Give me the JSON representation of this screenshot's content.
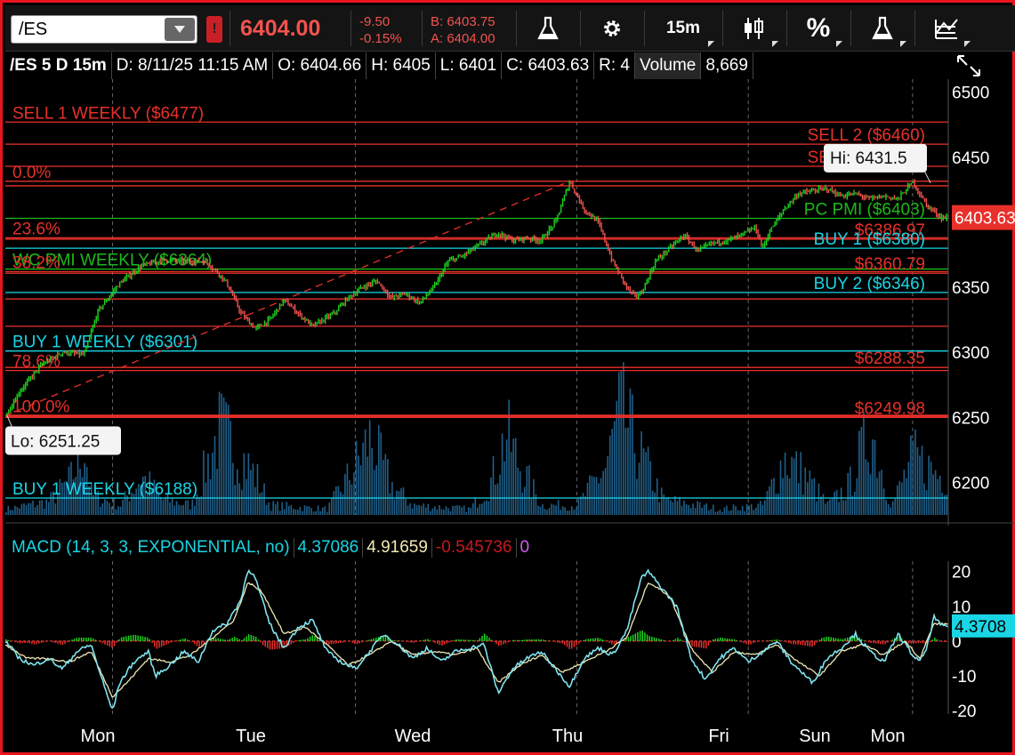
{
  "toolbar": {
    "symbol": "/ES",
    "alert_glyph": "!",
    "last": "6404.00",
    "change": "-9.50",
    "change_pct": "-0.15%",
    "bid": "B: 6403.75",
    "ask": "A: 6404.00",
    "timeframe": "15m",
    "percent": "%",
    "icons": [
      "flask-icon",
      "gear-icon",
      "timeframe-button",
      "candle-style-icon",
      "percent-icon",
      "flask-icon",
      "drawing-icon"
    ]
  },
  "info": {
    "symbol": "/ES 5 D 15m",
    "date": "D: 8/11/25 11:15 AM",
    "open": "O: 6404.66",
    "high": "H: 6405",
    "low": "L: 6401",
    "close": "C: 6403.63",
    "range": "R: 4",
    "vol_label": "Volume",
    "vol_value": "8,669"
  },
  "colors": {
    "up": "#1ed41e",
    "down": "#f2534e",
    "red_line": "#e8302a",
    "cyan_line": "#19d5e5",
    "green_line": "#1bb91b",
    "volume": "#1f5f8a",
    "macd": "#7fe3ef",
    "signal": "#f0e9b4"
  },
  "chart_data": [
    {
      "type": "candlestick",
      "ylim": [
        6175,
        6510
      ],
      "y_ticks": [
        6200,
        6250,
        6300,
        6350,
        6400,
        6450,
        6500
      ],
      "x_ticks": [
        "Mon",
        "Tue",
        "Wed",
        "Thu",
        "Fri",
        "Sun",
        "Mon"
      ],
      "grid": false,
      "price_path": [
        [
          0,
          6251
        ],
        [
          2,
          6270
        ],
        [
          5,
          6290
        ],
        [
          8,
          6300
        ],
        [
          11,
          6298
        ],
        [
          13,
          6332
        ],
        [
          16,
          6353
        ],
        [
          19,
          6366
        ],
        [
          22,
          6371
        ],
        [
          25,
          6370
        ],
        [
          28,
          6370
        ],
        [
          30,
          6360
        ],
        [
          31,
          6353
        ],
        [
          33,
          6330
        ],
        [
          35,
          6318
        ],
        [
          37,
          6325
        ],
        [
          39,
          6340
        ],
        [
          41,
          6330
        ],
        [
          43,
          6320
        ],
        [
          46,
          6330
        ],
        [
          48,
          6342
        ],
        [
          50,
          6350
        ],
        [
          52,
          6355
        ],
        [
          54,
          6342
        ],
        [
          56,
          6345
        ],
        [
          58,
          6338
        ],
        [
          60,
          6350
        ],
        [
          62,
          6370
        ],
        [
          64,
          6374
        ],
        [
          67,
          6385
        ],
        [
          69,
          6392
        ],
        [
          71,
          6386
        ],
        [
          73,
          6388
        ],
        [
          75,
          6386
        ],
        [
          77,
          6400
        ],
        [
          79,
          6431.5
        ],
        [
          81,
          6410
        ],
        [
          83,
          6400
        ],
        [
          85,
          6370
        ],
        [
          87,
          6350
        ],
        [
          88,
          6343
        ],
        [
          89,
          6345
        ],
        [
          91,
          6370
        ],
        [
          93,
          6380
        ],
        [
          95,
          6390
        ],
        [
          97,
          6378
        ],
        [
          99,
          6384
        ],
        [
          101,
          6386
        ],
        [
          103,
          6390
        ],
        [
          105,
          6396
        ],
        [
          106,
          6380
        ],
        [
          107,
          6393
        ],
        [
          109,
          6410
        ],
        [
          111,
          6422
        ],
        [
          113,
          6424
        ],
        [
          115,
          6426
        ],
        [
          117,
          6420
        ],
        [
          119,
          6422
        ],
        [
          121,
          6418
        ],
        [
          123,
          6420
        ],
        [
          125,
          6418
        ],
        [
          127,
          6431
        ],
        [
          129,
          6413
        ],
        [
          131,
          6403.63
        ]
      ],
      "x_max": 132,
      "hi_label": "Hi: 6431.5",
      "lo_label": "Lo: 6251.25",
      "hi": 6431.5,
      "lo": 6251.25,
      "last_price_label": "6403.63",
      "fib_trend": {
        "from": [
          0,
          6251.25
        ],
        "to": [
          79,
          6431.5
        ]
      },
      "levels": [
        {
          "price": 6477,
          "color": "red",
          "label": "SELL 1 WEEKLY ($6477)",
          "label_side": "left"
        },
        {
          "price": 6460,
          "color": "red",
          "label": "SELL 2 ($6460)",
          "label_side": "right"
        },
        {
          "price": 6443,
          "color": "red",
          "label": "SELL 1 ($6443)",
          "label_side": "right"
        },
        {
          "price": 6431.5,
          "color": "red",
          "label": "0.0%",
          "label_side": "left"
        },
        {
          "price": 6428,
          "color": "red",
          "label": "",
          "label_side": "left"
        },
        {
          "price": 6403,
          "color": "green",
          "label": "PC PMI ($6403)",
          "label_side": "right"
        },
        {
          "price": 6386.97,
          "color": "red",
          "label": "$6386.97",
          "label_side": "right"
        },
        {
          "price": 6388,
          "color": "red",
          "label": "23.6%",
          "label_side": "left"
        },
        {
          "price": 6380,
          "color": "cyan",
          "label": "BUY 1 ($6380)",
          "label_side": "right"
        },
        {
          "price": 6364,
          "color": "green",
          "label": "WC PMI WEEKLY ($6364)",
          "label_side": "left"
        },
        {
          "price": 6362,
          "color": "red",
          "label": "38.2%",
          "label_side": "left"
        },
        {
          "price": 6360.79,
          "color": "red",
          "label": "$6360.79",
          "label_side": "right"
        },
        {
          "price": 6346,
          "color": "cyan",
          "label": "BUY 2 ($6346)",
          "label_side": "right"
        },
        {
          "price": 6341,
          "color": "red",
          "label": "",
          "label_side": "left"
        },
        {
          "price": 6320,
          "color": "red",
          "label": "",
          "label_side": "left"
        },
        {
          "price": 6301,
          "color": "cyan",
          "label": "BUY 1 WEEKLY ($6301)",
          "label_side": "left"
        },
        {
          "price": 6288.35,
          "color": "red",
          "label": "$6288.35",
          "label_side": "right"
        },
        {
          "price": 6286,
          "color": "red",
          "label": "78.6%",
          "label_side": "left"
        },
        {
          "price": 6251.25,
          "color": "red",
          "label": "100.0%",
          "label_side": "left",
          "thick": true
        },
        {
          "price": 6249.98,
          "color": "red",
          "label": "$6249.98",
          "label_side": "right"
        },
        {
          "price": 6188,
          "color": "cyan",
          "label": "BUY 1 WEEKLY ($6188)",
          "label_side": "left"
        }
      ],
      "volume_path": [
        [
          0,
          0.03
        ],
        [
          6,
          0.07
        ],
        [
          9,
          0.18
        ],
        [
          11,
          0.35
        ],
        [
          12,
          0.1
        ],
        [
          16,
          0.05
        ],
        [
          19,
          0.2
        ],
        [
          22,
          0.08
        ],
        [
          26,
          0.05
        ],
        [
          30,
          0.45
        ],
        [
          32,
          0.35
        ],
        [
          35,
          0.2
        ],
        [
          37,
          0.05
        ],
        [
          45,
          0.03
        ],
        [
          48,
          0.2
        ],
        [
          51,
          0.4
        ],
        [
          54,
          0.15
        ],
        [
          57,
          0.05
        ],
        [
          65,
          0.03
        ],
        [
          68,
          0.18
        ],
        [
          70,
          0.42
        ],
        [
          72,
          0.25
        ],
        [
          75,
          0.05
        ],
        [
          80,
          0.05
        ],
        [
          84,
          0.25
        ],
        [
          86,
          0.55
        ],
        [
          89,
          0.3
        ],
        [
          92,
          0.08
        ],
        [
          100,
          0.03
        ],
        [
          106,
          0.05
        ],
        [
          109,
          0.3
        ],
        [
          112,
          0.2
        ],
        [
          115,
          0.05
        ],
        [
          118,
          0.15
        ],
        [
          121,
          0.45
        ],
        [
          124,
          0.05
        ],
        [
          127,
          0.3
        ],
        [
          129,
          0.25
        ],
        [
          131,
          0.2
        ]
      ],
      "volume_ylim": [
        0,
        1
      ]
    },
    {
      "type": "line",
      "title": "MACD (14, 3, 3, EXPONENTIAL, no)",
      "values": {
        "macd": "4.37086",
        "signal": "4.91659",
        "histogram": "-0.545736",
        "zero": "0"
      },
      "last_label": "4.3708",
      "ylim": [
        -21,
        23
      ],
      "y_ticks": [
        20,
        10,
        0,
        -10,
        -20
      ],
      "x_max": 132,
      "macd_path": [
        [
          0,
          0
        ],
        [
          2,
          -5
        ],
        [
          4,
          -7
        ],
        [
          6,
          -5
        ],
        [
          8,
          -8
        ],
        [
          10,
          -3
        ],
        [
          12,
          -1
        ],
        [
          14,
          -14
        ],
        [
          15,
          -20
        ],
        [
          16,
          -12
        ],
        [
          18,
          -6
        ],
        [
          20,
          -3
        ],
        [
          21,
          -10
        ],
        [
          23,
          -7
        ],
        [
          25,
          -3
        ],
        [
          27,
          -6
        ],
        [
          29,
          3
        ],
        [
          31,
          5
        ],
        [
          33,
          12
        ],
        [
          34,
          21
        ],
        [
          35,
          18
        ],
        [
          37,
          5
        ],
        [
          39,
          -2
        ],
        [
          41,
          4
        ],
        [
          43,
          6
        ],
        [
          45,
          -3
        ],
        [
          47,
          -6
        ],
        [
          49,
          -8
        ],
        [
          51,
          -3
        ],
        [
          53,
          2
        ],
        [
          55,
          -1
        ],
        [
          57,
          -5
        ],
        [
          59,
          -2
        ],
        [
          61,
          -6
        ],
        [
          63,
          -3
        ],
        [
          65,
          -2
        ],
        [
          67,
          -1
        ],
        [
          69,
          -15
        ],
        [
          71,
          -8
        ],
        [
          73,
          -5
        ],
        [
          75,
          -3
        ],
        [
          77,
          -8
        ],
        [
          79,
          -13
        ],
        [
          81,
          -5
        ],
        [
          83,
          -2
        ],
        [
          85,
          -4
        ],
        [
          87,
          3
        ],
        [
          89,
          18
        ],
        [
          90,
          20
        ],
        [
          92,
          15
        ],
        [
          94,
          10
        ],
        [
          96,
          -5
        ],
        [
          98,
          -11
        ],
        [
          100,
          -5
        ],
        [
          102,
          -2
        ],
        [
          104,
          -6
        ],
        [
          106,
          -3
        ],
        [
          108,
          0
        ],
        [
          110,
          -6
        ],
        [
          111,
          -8
        ],
        [
          113,
          -12
        ],
        [
          115,
          -5
        ],
        [
          117,
          -2
        ],
        [
          119,
          2
        ],
        [
          121,
          -3
        ],
        [
          123,
          -6
        ],
        [
          125,
          2
        ],
        [
          127,
          -4
        ],
        [
          128,
          -6
        ],
        [
          129,
          -2
        ],
        [
          130,
          7
        ],
        [
          131,
          4.37
        ]
      ],
      "signal_path": [
        [
          0,
          -1
        ],
        [
          3,
          -5
        ],
        [
          6,
          -5
        ],
        [
          9,
          -6
        ],
        [
          12,
          -3
        ],
        [
          15,
          -16
        ],
        [
          17,
          -12
        ],
        [
          20,
          -5
        ],
        [
          23,
          -6
        ],
        [
          26,
          -4
        ],
        [
          29,
          1
        ],
        [
          32,
          6
        ],
        [
          34,
          17
        ],
        [
          36,
          14
        ],
        [
          39,
          2
        ],
        [
          42,
          4
        ],
        [
          45,
          -1
        ],
        [
          48,
          -7
        ],
        [
          51,
          -4
        ],
        [
          54,
          0
        ],
        [
          57,
          -4
        ],
        [
          60,
          -3
        ],
        [
          63,
          -4
        ],
        [
          66,
          -2
        ],
        [
          69,
          -12
        ],
        [
          72,
          -7
        ],
        [
          75,
          -4
        ],
        [
          78,
          -9
        ],
        [
          81,
          -6
        ],
        [
          84,
          -3
        ],
        [
          87,
          1
        ],
        [
          90,
          17
        ],
        [
          93,
          13
        ],
        [
          96,
          -2
        ],
        [
          99,
          -9
        ],
        [
          102,
          -3
        ],
        [
          105,
          -4
        ],
        [
          108,
          -1
        ],
        [
          111,
          -6
        ],
        [
          114,
          -10
        ],
        [
          117,
          -3
        ],
        [
          120,
          -1
        ],
        [
          123,
          -4
        ],
        [
          126,
          0
        ],
        [
          128,
          -5
        ],
        [
          130,
          5
        ],
        [
          131,
          4.92
        ]
      ]
    }
  ]
}
